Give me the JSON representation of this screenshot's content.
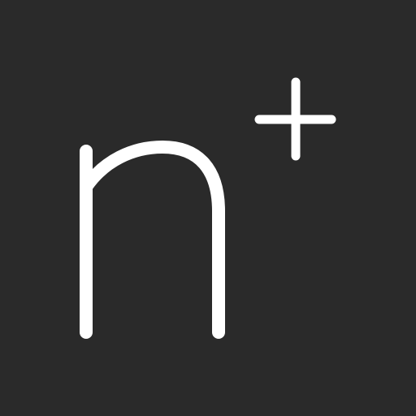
{
  "logo": {
    "text": "n+",
    "icon": "n-plus-logo-icon"
  },
  "colors": {
    "background": "#2a2a2a",
    "foreground": "#ffffff"
  }
}
